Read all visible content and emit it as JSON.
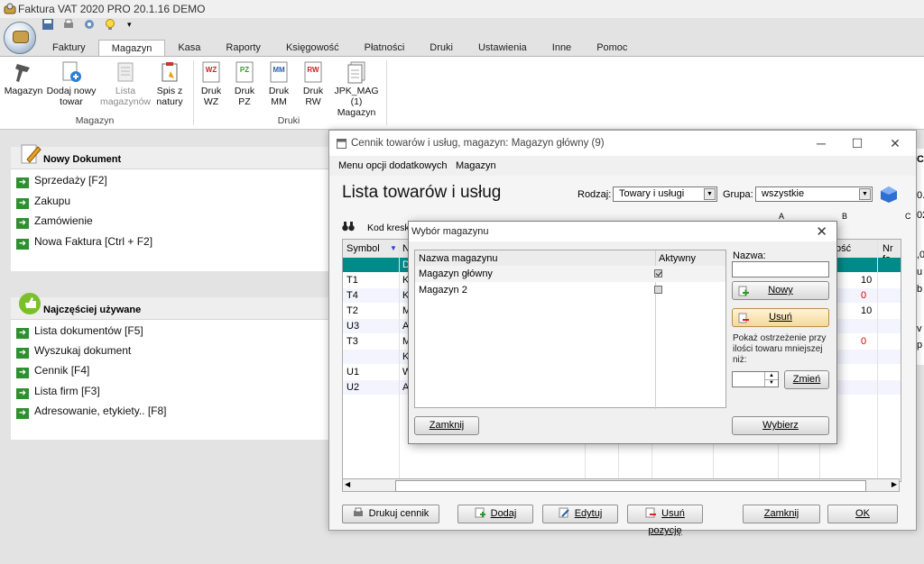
{
  "app": {
    "title": "Faktura VAT 2020 PRO 20.1.16 DEMO"
  },
  "ribbon": {
    "tabs": [
      "Faktury",
      "Magazyn",
      "Kasa",
      "Raporty",
      "Księgowość",
      "Płatności",
      "Druki",
      "Ustawienia",
      "Inne",
      "Pomoc"
    ],
    "active_tab": "Magazyn",
    "magazyn_group": {
      "label": "Magazyn",
      "buttons": [
        {
          "line1": "Magazyn",
          "line2": ""
        },
        {
          "line1": "Dodaj nowy",
          "line2": "towar"
        },
        {
          "line1": "Lista",
          "line2": "magazynów"
        },
        {
          "line1": "Spis z",
          "line2": "natury"
        }
      ]
    },
    "druki_group": {
      "label": "Druki",
      "buttons": [
        {
          "badge": "WZ",
          "line1": "Druk",
          "line2": "WZ"
        },
        {
          "badge": "PZ",
          "line1": "Druk",
          "line2": "PZ"
        },
        {
          "badge": "MM",
          "line1": "Druk",
          "line2": "MM"
        },
        {
          "badge": "RW",
          "line1": "Druk",
          "line2": "RW"
        },
        {
          "badge": "",
          "line1": "JPK_MAG (1)",
          "line2": "Magazyn"
        }
      ]
    }
  },
  "left": {
    "new_doc": {
      "title": "Nowy Dokument",
      "links": [
        "Sprzedaży [F2]",
        "Zakupu",
        "Zamówienie",
        "Nowa Faktura [Ctrl + F2]"
      ]
    },
    "frequent": {
      "title": "Najczęściej używane",
      "links": [
        "Lista dokumentów [F5]",
        "Wyszukaj dokument",
        "Cennik [F4]",
        "Lista firm [F3]",
        "Adresowanie, etykiety.. [F8]"
      ]
    }
  },
  "main_window": {
    "title": "Cennik towarów i usług, magazyn: Magazyn główny (9)",
    "menu": [
      "Menu opcji dodatkowych",
      "Magazyn"
    ],
    "heading": "Lista towarów i usług",
    "rodzaj_label": "Rodzaj:",
    "rodzaj_value": "Towary i usługi",
    "grupa_label": "Grupa:",
    "grupa_value": "wszystkie",
    "kod_label": "Kod kresk",
    "col_letters": [
      "A",
      "B",
      "C"
    ],
    "columns": {
      "symbol": "Symbol",
      "n": "N",
      "ilosc": "ość",
      "nr": "Nr fa"
    },
    "rows": [
      {
        "symbol": "",
        "n": "D",
        "qty": "",
        "red": false,
        "selected": true
      },
      {
        "symbol": "T1",
        "n": "K",
        "qty": "10",
        "red": false
      },
      {
        "symbol": "T4",
        "n": "K",
        "qty": "0",
        "red": true
      },
      {
        "symbol": "T2",
        "n": "M",
        "qty": "10",
        "red": false
      },
      {
        "symbol": "U3",
        "n": "A",
        "qty": "",
        "red": false
      },
      {
        "symbol": "T3",
        "n": "M",
        "qty": "0",
        "red": true
      },
      {
        "symbol": "",
        "n": "K",
        "qty": "",
        "red": false
      },
      {
        "symbol": "U1",
        "n": "W",
        "qty": "",
        "red": false
      },
      {
        "symbol": "U2",
        "n": "A",
        "qty": "",
        "red": false
      }
    ],
    "buttons": {
      "drukuj": "Drukuj cennik",
      "dodaj": "Dodaj",
      "edytuj": "Edytuj",
      "usun": "Usuń pozycję",
      "zamknij": "Zamknij",
      "ok": "OK"
    }
  },
  "dialog": {
    "title": "Wybór magazynu",
    "col_name": "Nazwa magazynu",
    "col_active": "Aktywny",
    "rows": [
      {
        "name": "Magazyn główny",
        "active": true
      },
      {
        "name": "Magazyn 2",
        "active": false
      }
    ],
    "nazwa_label": "Nazwa:",
    "nazwa_value": "",
    "nowy": "Nowy",
    "usun": "Usuń",
    "warning_text": "Pokaż ostrzeżenie przy ilości towaru mniejszej niż:",
    "threshold_value": "",
    "zmien": "Zmień",
    "zamknij": "Zamknij",
    "wybierz": "Wybierz"
  },
  "right_clip": [
    "C",
    "0.",
    "02",
    ",0",
    "u",
    "b",
    "v",
    "p"
  ],
  "colors": {
    "selection": "#008b8b",
    "negative": "#d00000",
    "link_arrow": "#2f8f2f"
  }
}
